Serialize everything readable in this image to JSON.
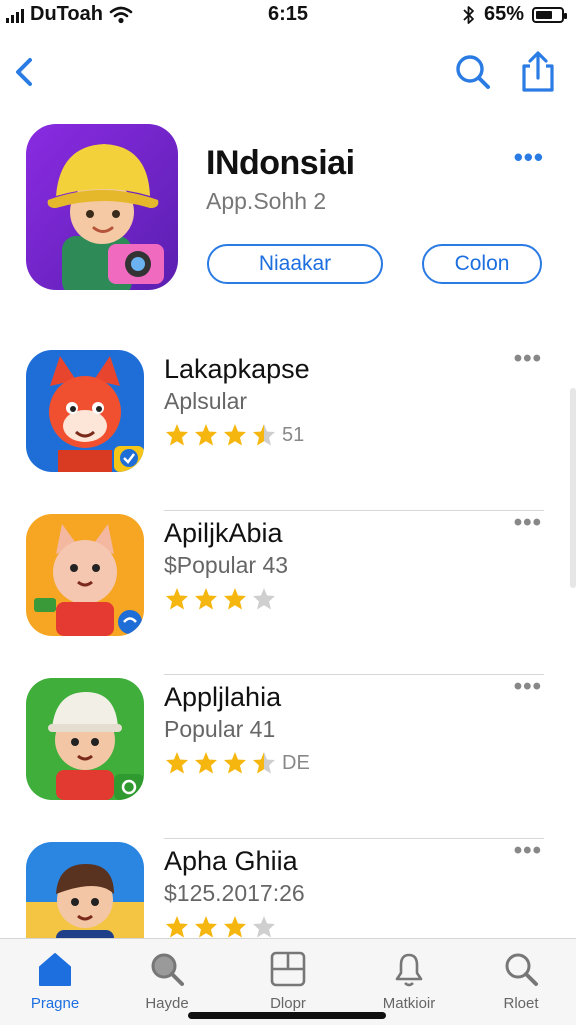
{
  "status_bar": {
    "carrier": "DuToah",
    "time": "6:15",
    "battery": "65%",
    "battery_level": 0.65
  },
  "nav": {
    "back_icon": "chevron-left-icon",
    "search_icon": "search-icon",
    "share_icon": "share-icon",
    "accent": "#2a7be4"
  },
  "hero": {
    "title": "INdonsiai",
    "subtitle": "App.Sohh  2",
    "more": "•••",
    "primary_button": "Niaakar",
    "secondary_button": "Colon"
  },
  "apps": [
    {
      "title": "Lakapkapse",
      "subtitle": "Aplsular",
      "rating": 3.5,
      "rating_text": "51",
      "more": "•••"
    },
    {
      "title": "ApiljkAbia",
      "subtitle": "$Popular 43",
      "rating": 3,
      "rating_text": "",
      "more": "•••"
    },
    {
      "title": "Appljlahia",
      "subtitle": "Popular 41",
      "rating": 3.5,
      "rating_text": "DE",
      "more": "•••"
    },
    {
      "title": "Apha Ghiia",
      "subtitle": "$125.2017:26",
      "rating": 3,
      "rating_text": "",
      "more": "•••"
    }
  ],
  "tab_bar": {
    "tabs": [
      {
        "label": "Pragne",
        "icon": "home-icon",
        "active": true
      },
      {
        "label": "Hayde",
        "icon": "search-icon",
        "active": false
      },
      {
        "label": "Dlopr",
        "icon": "apps-icon",
        "active": false
      },
      {
        "label": "Matkioir",
        "icon": "bell-icon",
        "active": false
      },
      {
        "label": "Rloet",
        "icon": "search-icon",
        "active": false
      }
    ]
  },
  "colors": {
    "accent": "#2a7be4",
    "star": "#f5b70f",
    "star_empty": "#cfcfcf"
  }
}
